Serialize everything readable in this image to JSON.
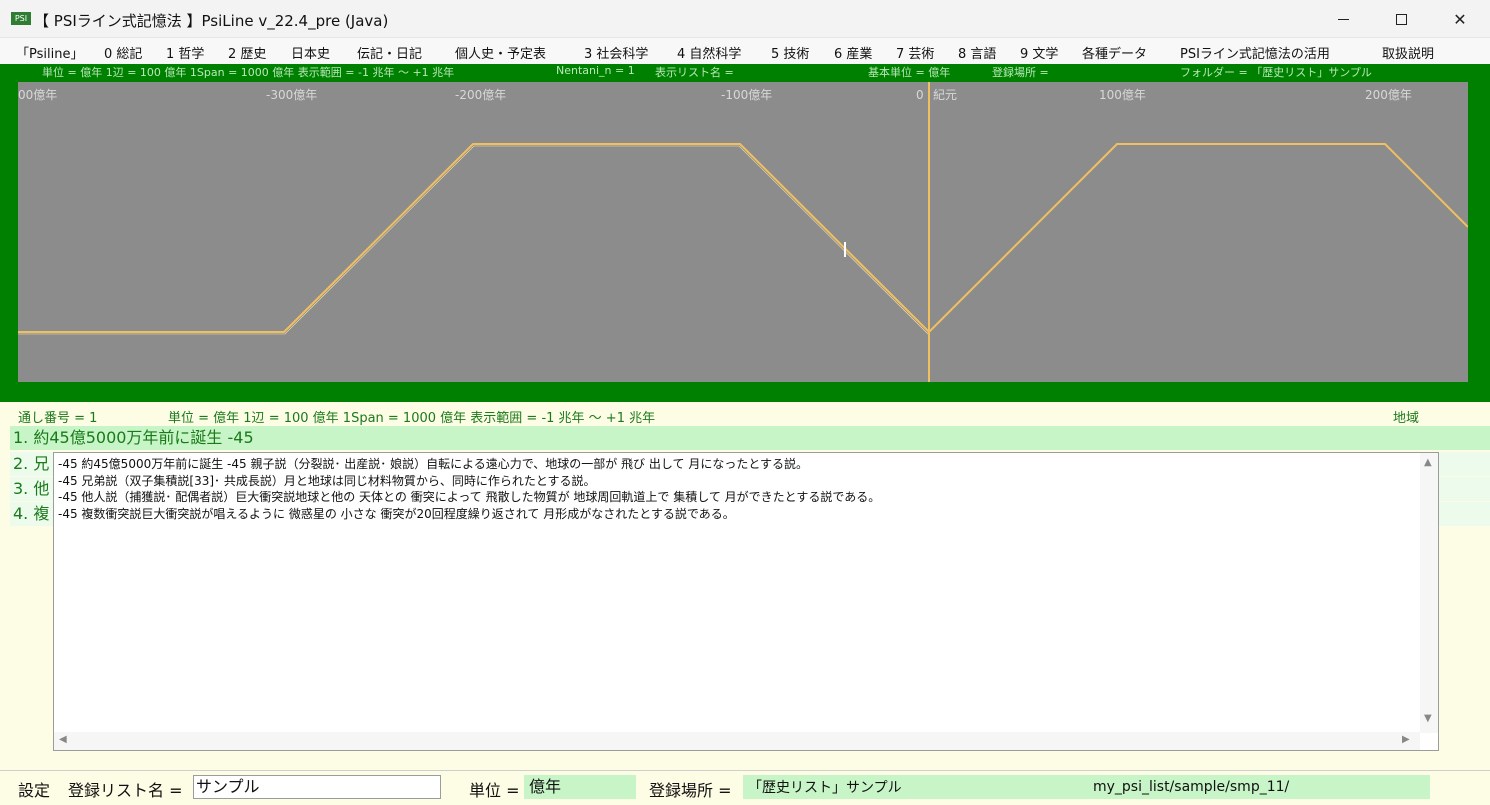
{
  "window": {
    "icon_text": "PSI",
    "title": "【 PSIライン式記憶法 】PsiLine v_22.4_pre (Java)"
  },
  "menu": [
    "「Psiline」",
    "0 総記",
    "1 哲学",
    "2 歴史",
    "日本史",
    "伝記・日記",
    "個人史・予定表",
    "3 社会科学",
    "4 自然科学",
    "5 技術",
    "6 産業",
    "7 芸術",
    "8 言語",
    "9 文学",
    "各種データ",
    "PSIライン式記憶法の活用",
    "取扱説明"
  ],
  "chart_header": {
    "unit_info": "単位 = 億年  1辺 = 100 億年  1Span = 1000 億年  表示範囲 = -1 兆年 〜 +1 兆年",
    "nentani": "Nentani_n = 1",
    "list_name": "表示リスト名 =",
    "base_unit": "基本単位 = 億年",
    "location": "登録場所 =",
    "folder": "フォルダー = 「歴史リスト」サンプル"
  },
  "chart_data": {
    "type": "line",
    "x_ticks": [
      "00億年",
      "-300億年",
      "-200億年",
      "-100億年",
      "0",
      "紀元",
      "100億年",
      "200億年"
    ],
    "line_color": "#f0c060",
    "background": "#8c8c8c"
  },
  "info_bar": {
    "serial": "通し番号 = 1",
    "unit_info": "単位 = 億年  1辺 = 100 億年  1Span = 1000 億年  表示範囲 = -1 兆年 〜 +1 兆年",
    "region": "地域"
  },
  "rows": [
    "1. 約45億5000万年前に誕生 -45",
    "2. 兄",
    "3. 他",
    "4. 複"
  ],
  "text_lines": [
    "-45  約45億5000万年前に誕生 -45  親子説（分裂説･ 出産説･ 娘説）自転による遠心力で、地球の一部が 飛び 出して 月になったとする説。",
    "-45  兄弟説（双子集積説[33]･ 共成長説）月と地球は同じ材料物質から、同時に作られたとする説。",
    "-45  他人説（捕獲説･ 配偶者説）巨大衝突説地球と他の 天体との 衝突によって 飛散した物質が 地球周回軌道上で 集積して 月ができたとする説である。",
    "-45  複数衝突説巨大衝突説が唱えるように 微惑星の 小さな 衝突が20回程度繰り返されて 月形成がなされたとする説である。"
  ],
  "bottom": {
    "settings": "設定",
    "list_name_label": "登録リスト名 =",
    "list_name_value": "サンプル",
    "unit_label": "単位 =",
    "unit_value": "億年",
    "location_label": "登録場所 =",
    "location_value": "「歴史リスト」サンプル",
    "path": "my_psi_list/sample/smp_11/"
  }
}
